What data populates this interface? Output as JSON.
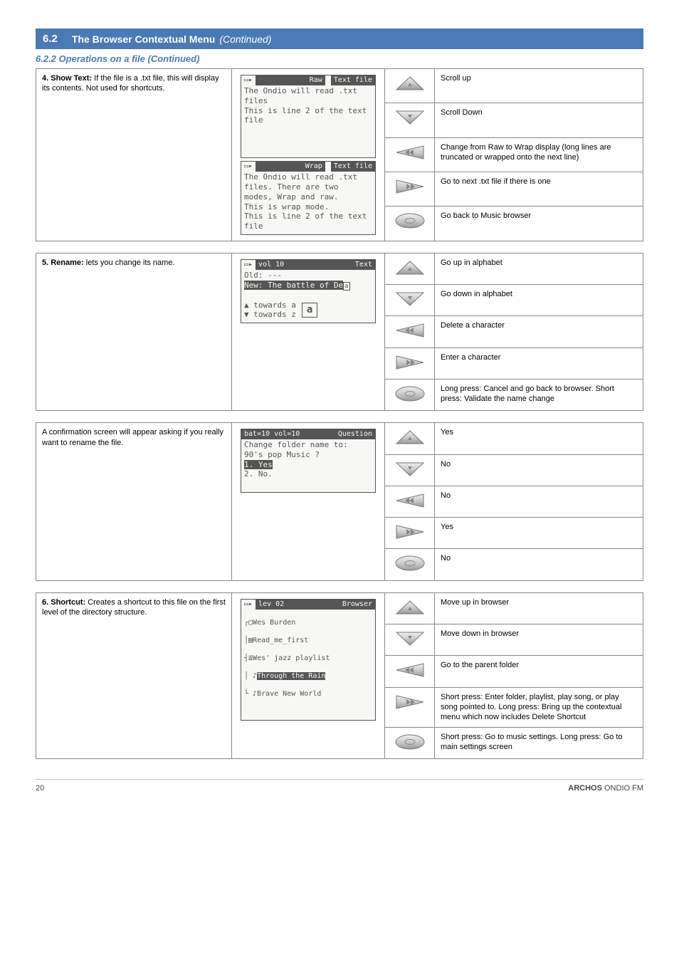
{
  "header": {
    "number": "6.2",
    "title": "The Browser Contextual Menu",
    "continued": "(Continued)"
  },
  "subheads": {
    "file_ops": "6.2.2 Operations on a file (Continued)"
  },
  "rows": {
    "showtxt": {
      "head": "4. Show Text:",
      "body": " If the file is a .txt file, this will display its contents. Not used for shortcuts.",
      "lcd_raw_tag1": "Raw",
      "lcd_raw_tag2": "Text file",
      "lcd_raw_l1": "The Ondio will read .txt files",
      "lcd_raw_l2": "This is line 2 of the text file",
      "lcd_wrap_tag1": "Wrap",
      "lcd_wrap_tag2": "Text file",
      "lcd_wrap_l1": "The Ondio will read .txt",
      "lcd_wrap_l2": "files.  There are two",
      "lcd_wrap_l3": "modes, Wrap and raw.",
      "lcd_wrap_l4": "This is wrap mode.",
      "lcd_wrap_l5": "This is line 2 of the text file",
      "act_up": "Scroll up",
      "act_down": "Scroll Down",
      "act_left": "Change from Raw to Wrap display (long lines are truncated or wrapped onto the next line)",
      "act_right": "Go to next .txt file if there is one",
      "act_menu": "Go back to Music browser"
    },
    "rename": {
      "head": "5. Rename:",
      "body": " lets you change its name.",
      "lcd_tag1": "vol 10",
      "lcd_tag2": "Text",
      "lcd_l1": "Old: ---",
      "lcd_l2": "New: The battle of De",
      "lcd_box": "a",
      "lcd_hint_up": "▲ towards a",
      "lcd_hint_dn": "▼ towards z",
      "act_up": "Go up in alphabet",
      "act_down": "Go down in alphabet",
      "act_left": "Delete a character",
      "act_right": "Enter a character",
      "act_menu": "Long press: Cancel and go back to browser. Short press: Validate the name change"
    },
    "confirm": {
      "desc": "A confirmation screen will appear asking if you really want to rename the file.",
      "lcd_tag1": "bat=10 vol=10",
      "lcd_tag2": "Question",
      "lcd_l1": "Change folder name to:",
      "lcd_l2": "90's pop Music ?",
      "lcd_l3": "1. Yes",
      "lcd_l4": "2. No.",
      "act_up": "Yes",
      "act_down": "No",
      "act_left": "No",
      "act_right": "Yes",
      "act_menu": "No"
    },
    "shortcut": {
      "head": "6. Shortcut:",
      "body": " Creates a shortcut to this file on the first level of the directory structure.",
      "lcd_tag1": "lev 02",
      "lcd_tag2": "Browser",
      "lcd_i1": "Wes Burden",
      "lcd_i2": "Read_me_first",
      "lcd_i3": "Wes' jazz playlist",
      "lcd_i4": "Through the Rain",
      "lcd_i5": "Brave New World",
      "act_up": "Move up in browser",
      "act_down": "Move down in browser",
      "act_left": "Go to the parent folder",
      "act_right": "Short press: Enter folder, playlist, play song, or play song pointed to. Long press: Bring up the contextual menu which now includes Delete Shortcut",
      "act_menu": "Short press: Go to music settings. Long press: Go to main settings screen"
    }
  },
  "footer": {
    "page": "20",
    "brand": "ARCHOS",
    "model": "ONDIO FM"
  }
}
